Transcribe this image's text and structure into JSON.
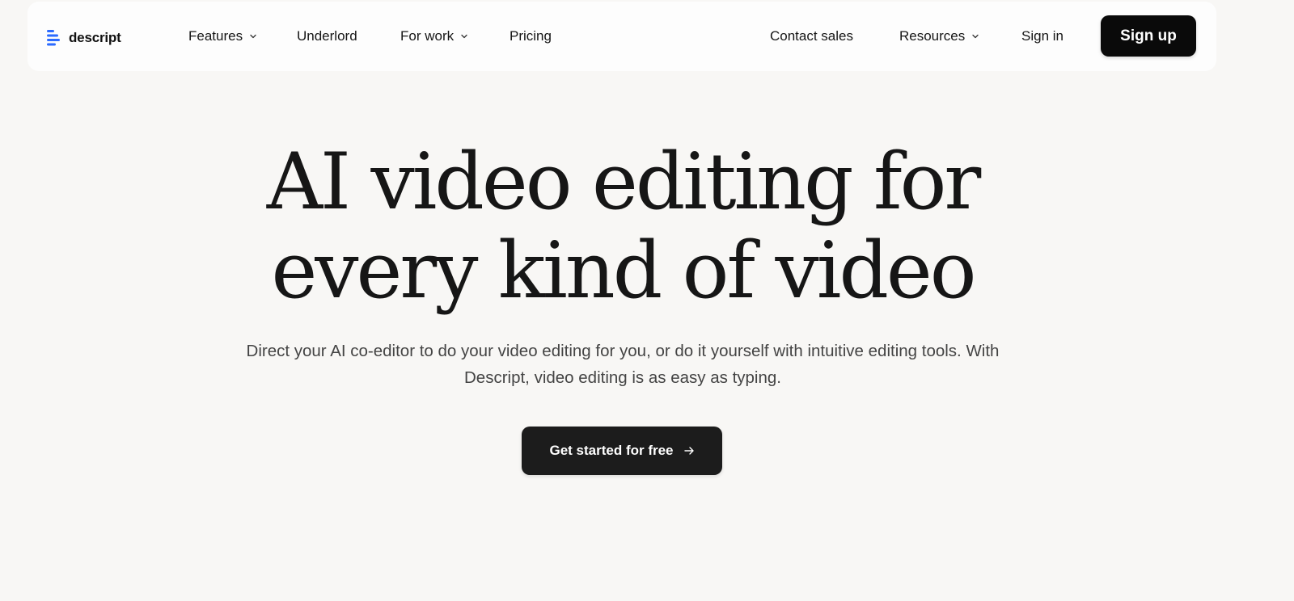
{
  "brand": {
    "name": "descript",
    "accent": "#2c6bff"
  },
  "nav": {
    "features": "Features",
    "underlord": "Underlord",
    "for_work": "For work",
    "pricing": "Pricing",
    "contact_sales": "Contact sales",
    "resources": "Resources",
    "sign_in": "Sign in",
    "sign_up": "Sign up"
  },
  "hero": {
    "title_line1": "AI video editing for",
    "title_line2": "every kind of video",
    "subtitle_line1": "Direct your AI co-editor to do your video editing for you, or do it yourself with intuitive editing tools. With",
    "subtitle_line2": "Descript, video editing is as easy as typing.",
    "cta": "Get started for free"
  },
  "colors": {
    "background": "#f8f7f5",
    "navbar": "#fdfdfd",
    "primary_button": "#0a0a0a",
    "cta_button": "#1c1c1c"
  }
}
